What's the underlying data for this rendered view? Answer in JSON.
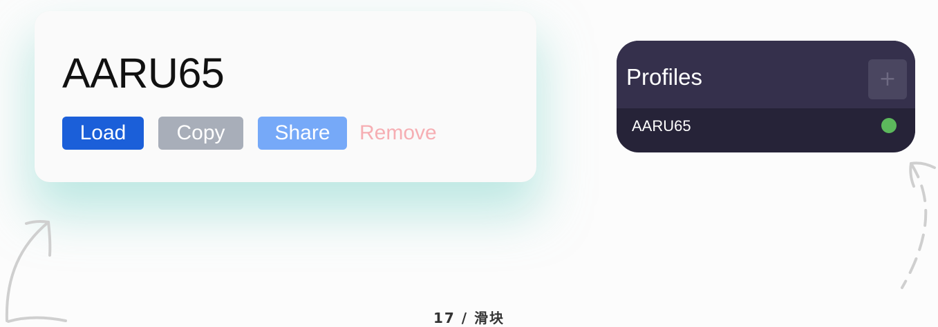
{
  "profile_card": {
    "name": "AARU65",
    "load_label": "Load",
    "copy_label": "Copy",
    "share_label": "Share",
    "remove_label": "Remove"
  },
  "profiles_panel": {
    "title": "Profiles",
    "add_icon": "plus-icon",
    "items": [
      {
        "label": "AARU65",
        "status": "active",
        "status_color": "#5cb85c"
      }
    ]
  },
  "caption": "17 / 滑块",
  "colors": {
    "load": "#1b5fd9",
    "copy": "#a8aeb9",
    "share": "#76a9f8",
    "remove": "#f6aeb3",
    "panel_bg": "#262338",
    "panel_header": "#35304c",
    "glow": "#8cd8d0"
  }
}
